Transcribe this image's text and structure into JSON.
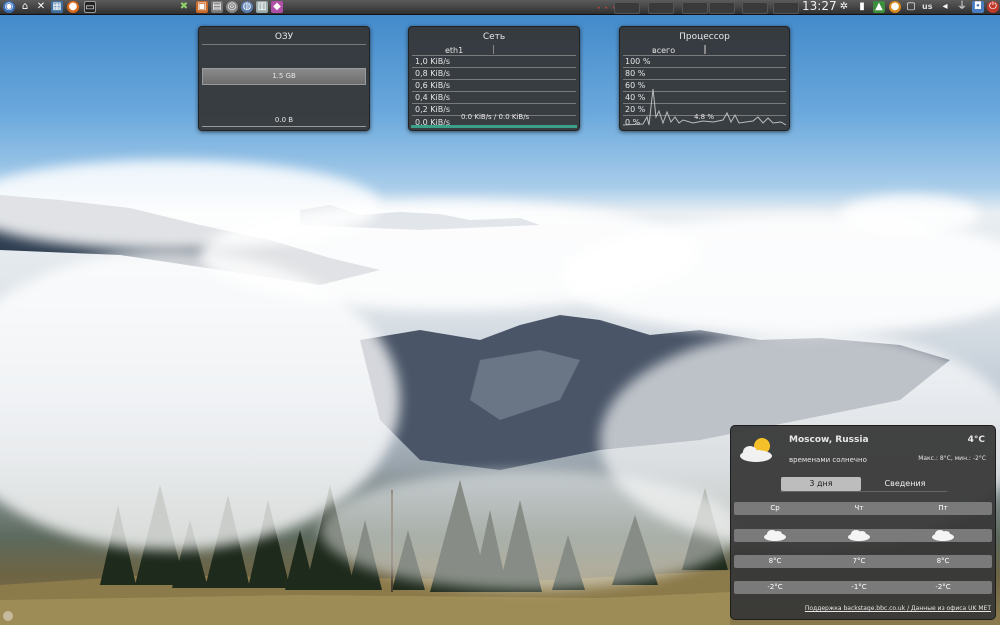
{
  "panel": {
    "clock": "13:27",
    "keyboard_layout": "us",
    "launchers": [
      "app-menu-icon",
      "home-folder-icon",
      "settings-tools-icon",
      "calculator-icon",
      "firefox-icon",
      "terminal-icon"
    ],
    "tray_left": [
      "network-tool-icon",
      "archive-icon",
      "media-icon",
      "disk-icon",
      "globe-icon",
      "document-icon",
      "app-icon"
    ]
  },
  "ram": {
    "title": "ОЗУ",
    "used": "1.5 GB",
    "bottom": "0.0 B"
  },
  "net": {
    "title": "Сеть",
    "interface": "eth1",
    "scale": [
      "1,0 KiB/s",
      "0,8 KiB/s",
      "0,6 KiB/s",
      "0,4 KiB/s",
      "0,2 KiB/s",
      "0,0 KiB/s"
    ],
    "rate": "0.0 KiB/s / 0.0 KiB/s"
  },
  "cpu": {
    "title": "Процессор",
    "label": "всего",
    "scale": [
      "100 %",
      "80 %",
      "60 %",
      "40 %",
      "20 %",
      "0 %"
    ],
    "current": "4.8 %"
  },
  "weather": {
    "location": "Moscow, Russia",
    "temp": "4°C",
    "condition": "временами солнечно",
    "maxmin": "Макс.: 8°C, мин.: -2°C",
    "tabs": [
      "3 дня",
      "Сведения"
    ],
    "days": [
      {
        "name": "Ср",
        "high": "8°C",
        "low": "-2°C"
      },
      {
        "name": "Чт",
        "high": "7°C",
        "low": "-1°C"
      },
      {
        "name": "Пт",
        "high": "8°C",
        "low": "-2°C"
      }
    ],
    "credit": "Поддержка backstage.bbc.co.uk / Данные из офиса UK MET"
  }
}
